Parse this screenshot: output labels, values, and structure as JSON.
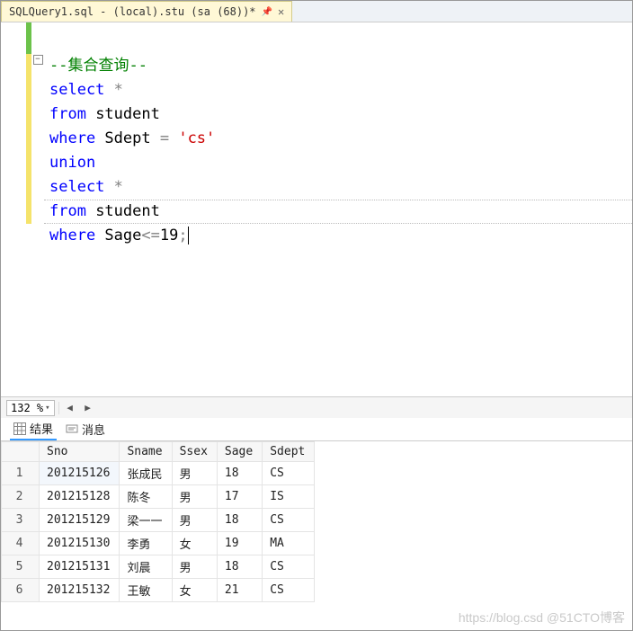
{
  "tab": {
    "title": "SQLQuery1.sql - (local).stu (sa (68))*"
  },
  "code": {
    "comment": "--集合查询--",
    "l1_kw": "select",
    "l1_rest": " *",
    "l2_kw": "from",
    "l2_rest": " student",
    "l3_kw": "where",
    "l3_id": " Sdept ",
    "l3_eq": "=",
    "l3_str": " 'cs'",
    "l4_kw": "union",
    "l5_kw": "select",
    "l5_rest": " *",
    "l6_kw": "from",
    "l6_rest": " student",
    "l7_kw": "where",
    "l7_id": " Sage",
    "l7_op": "<=",
    "l7_num": "19",
    "l7_semi": ";"
  },
  "zoom": {
    "value": "132 %"
  },
  "result_tabs": {
    "results": "结果",
    "messages": "消息"
  },
  "columns": [
    "",
    "Sno",
    "Sname",
    "Ssex",
    "Sage",
    "Sdept"
  ],
  "rows": [
    {
      "n": "1",
      "Sno": "201215126",
      "Sname": "张成民",
      "Ssex": "男",
      "Sage": "18",
      "Sdept": "CS"
    },
    {
      "n": "2",
      "Sno": "201215128",
      "Sname": "陈冬",
      "Ssex": "男",
      "Sage": "17",
      "Sdept": "IS"
    },
    {
      "n": "3",
      "Sno": "201215129",
      "Sname": "梁一一",
      "Ssex": "男",
      "Sage": "18",
      "Sdept": "CS"
    },
    {
      "n": "4",
      "Sno": "201215130",
      "Sname": "李勇",
      "Ssex": "女",
      "Sage": "19",
      "Sdept": "MA"
    },
    {
      "n": "5",
      "Sno": "201215131",
      "Sname": "刘晨",
      "Ssex": "男",
      "Sage": "18",
      "Sdept": "CS"
    },
    {
      "n": "6",
      "Sno": "201215132",
      "Sname": "王敏",
      "Ssex": "女",
      "Sage": "21",
      "Sdept": "CS"
    }
  ],
  "watermark": "https://blog.csd @51CTO博客"
}
